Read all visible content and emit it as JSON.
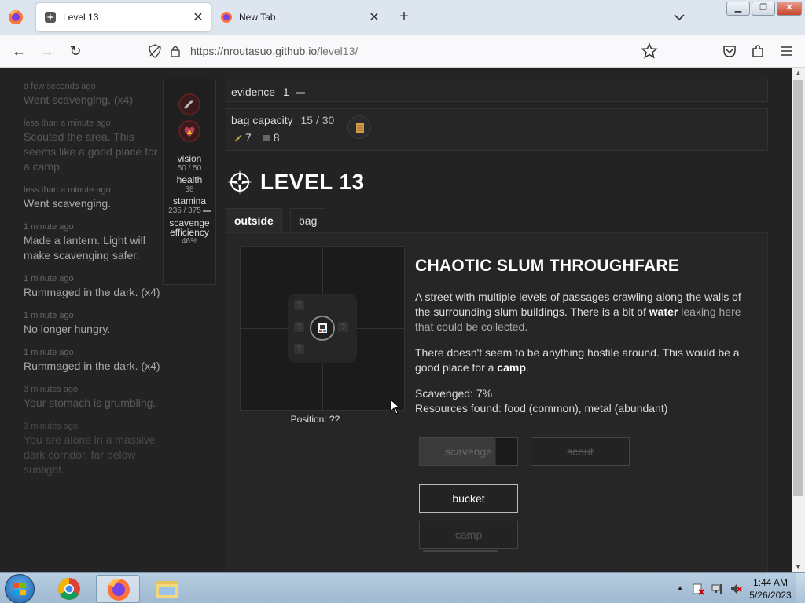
{
  "browser": {
    "tabs": [
      {
        "title": "Level 13",
        "active": true
      },
      {
        "title": "New Tab",
        "active": false
      }
    ],
    "url_host": "https://nroutasuo.github.io",
    "url_path": "/level13/"
  },
  "log": [
    {
      "time": "a few seconds ago",
      "text": "Went scavenging. (x4)"
    },
    {
      "time": "less than a minute ago",
      "text": "Scouted the area. This seems like a good place for a camp."
    },
    {
      "time": "less than a minute ago",
      "text": "Went scavenging."
    },
    {
      "time": "1 minute ago",
      "text": "Made a lantern. Light will make scavenging safer."
    },
    {
      "time": "1 minute ago",
      "text": "Rummaged in the dark. (x4)"
    },
    {
      "time": "1 minute ago",
      "text": "No longer hungry."
    },
    {
      "time": "1 minute ago",
      "text": "Rummaged in the dark. (x4)"
    },
    {
      "time": "3 minutes ago",
      "text": "Your stomach is grumbling."
    },
    {
      "time": "3 minutes ago",
      "text": "You are alone in a massive dark corridor, far below sunlight."
    }
  ],
  "stats": {
    "vision_label": "vision",
    "vision_value": "50 / 50",
    "health_label": "health",
    "health_value": "38",
    "stamina_label": "stamina",
    "stamina_value": "235 / 375",
    "scavenge_label": "scavenge efficiency",
    "scavenge_value": "46%"
  },
  "evidence": {
    "label": "evidence",
    "value": "1"
  },
  "bag": {
    "label": "bag capacity",
    "used": "15",
    "separator": "/",
    "capacity": "30",
    "resources": [
      {
        "icon": "food-icon",
        "value": "7"
      },
      {
        "icon": "metal-icon",
        "value": "8"
      }
    ]
  },
  "level": {
    "title": "LEVEL 13"
  },
  "tabs": {
    "outside": "outside",
    "bag": "bag"
  },
  "map": {
    "position_text": "Position: ??"
  },
  "sector": {
    "title": "CHAOTIC SLUM THROUGHFARE",
    "desc_part1": "A street with multiple levels of passages crawling along the walls of the surrounding slum buildings. There is a bit of ",
    "desc_water": "water",
    "desc_part2": " leaking here that could be collected.",
    "hostile_part1": "There doesn't seem to be anything hostile around. This would be a good place for a ",
    "hostile_camp": "camp",
    "hostile_part2": ".",
    "scavenged": "Scavenged: 7%",
    "resources_found": "Resources found: food (common), metal (abundant)"
  },
  "actions": {
    "scavenge": "scavenge",
    "scavenge_progress": 0.78,
    "scout": "scout",
    "bucket": "bucket",
    "camp": "camp"
  },
  "taskbar": {
    "time": "1:44 AM",
    "date": "5/26/2023"
  }
}
